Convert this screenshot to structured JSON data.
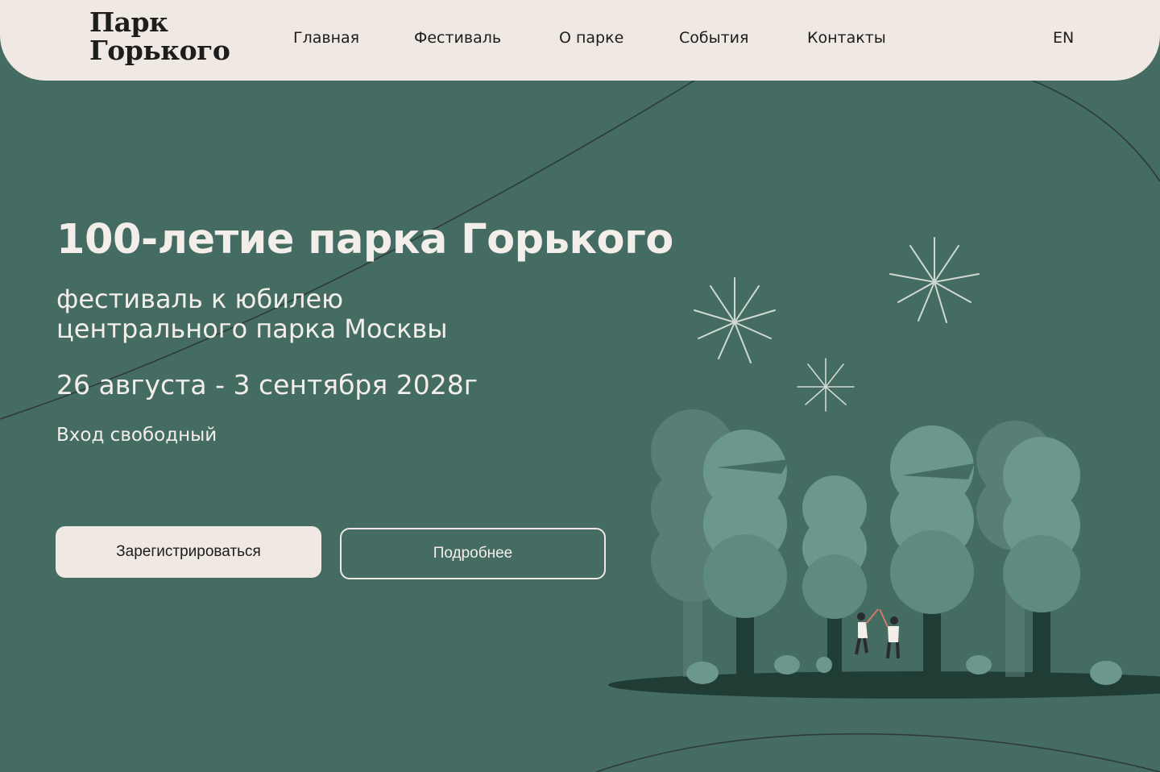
{
  "header": {
    "logo_line1": "Парк",
    "logo_line2": "Горького",
    "nav": [
      {
        "label": "Главная"
      },
      {
        "label": "Фестиваль"
      },
      {
        "label": "О парке"
      },
      {
        "label": "События"
      },
      {
        "label": "Контакты"
      }
    ],
    "lang": "EN"
  },
  "hero": {
    "title": "100-летие парка Горького",
    "subtitle_line1": "фестиваль к юбилею",
    "subtitle_line2": "центрального парка Москвы",
    "dates": "26 августа - 3 сентября 2028г",
    "entry": "Вход свободный",
    "register_button": "Зарегистрироваться",
    "more_button": "Подробнее"
  },
  "colors": {
    "background": "#446c62",
    "header": "#efe8e3",
    "text_light": "#f3eee9",
    "text_dark": "#1d1d1b"
  }
}
